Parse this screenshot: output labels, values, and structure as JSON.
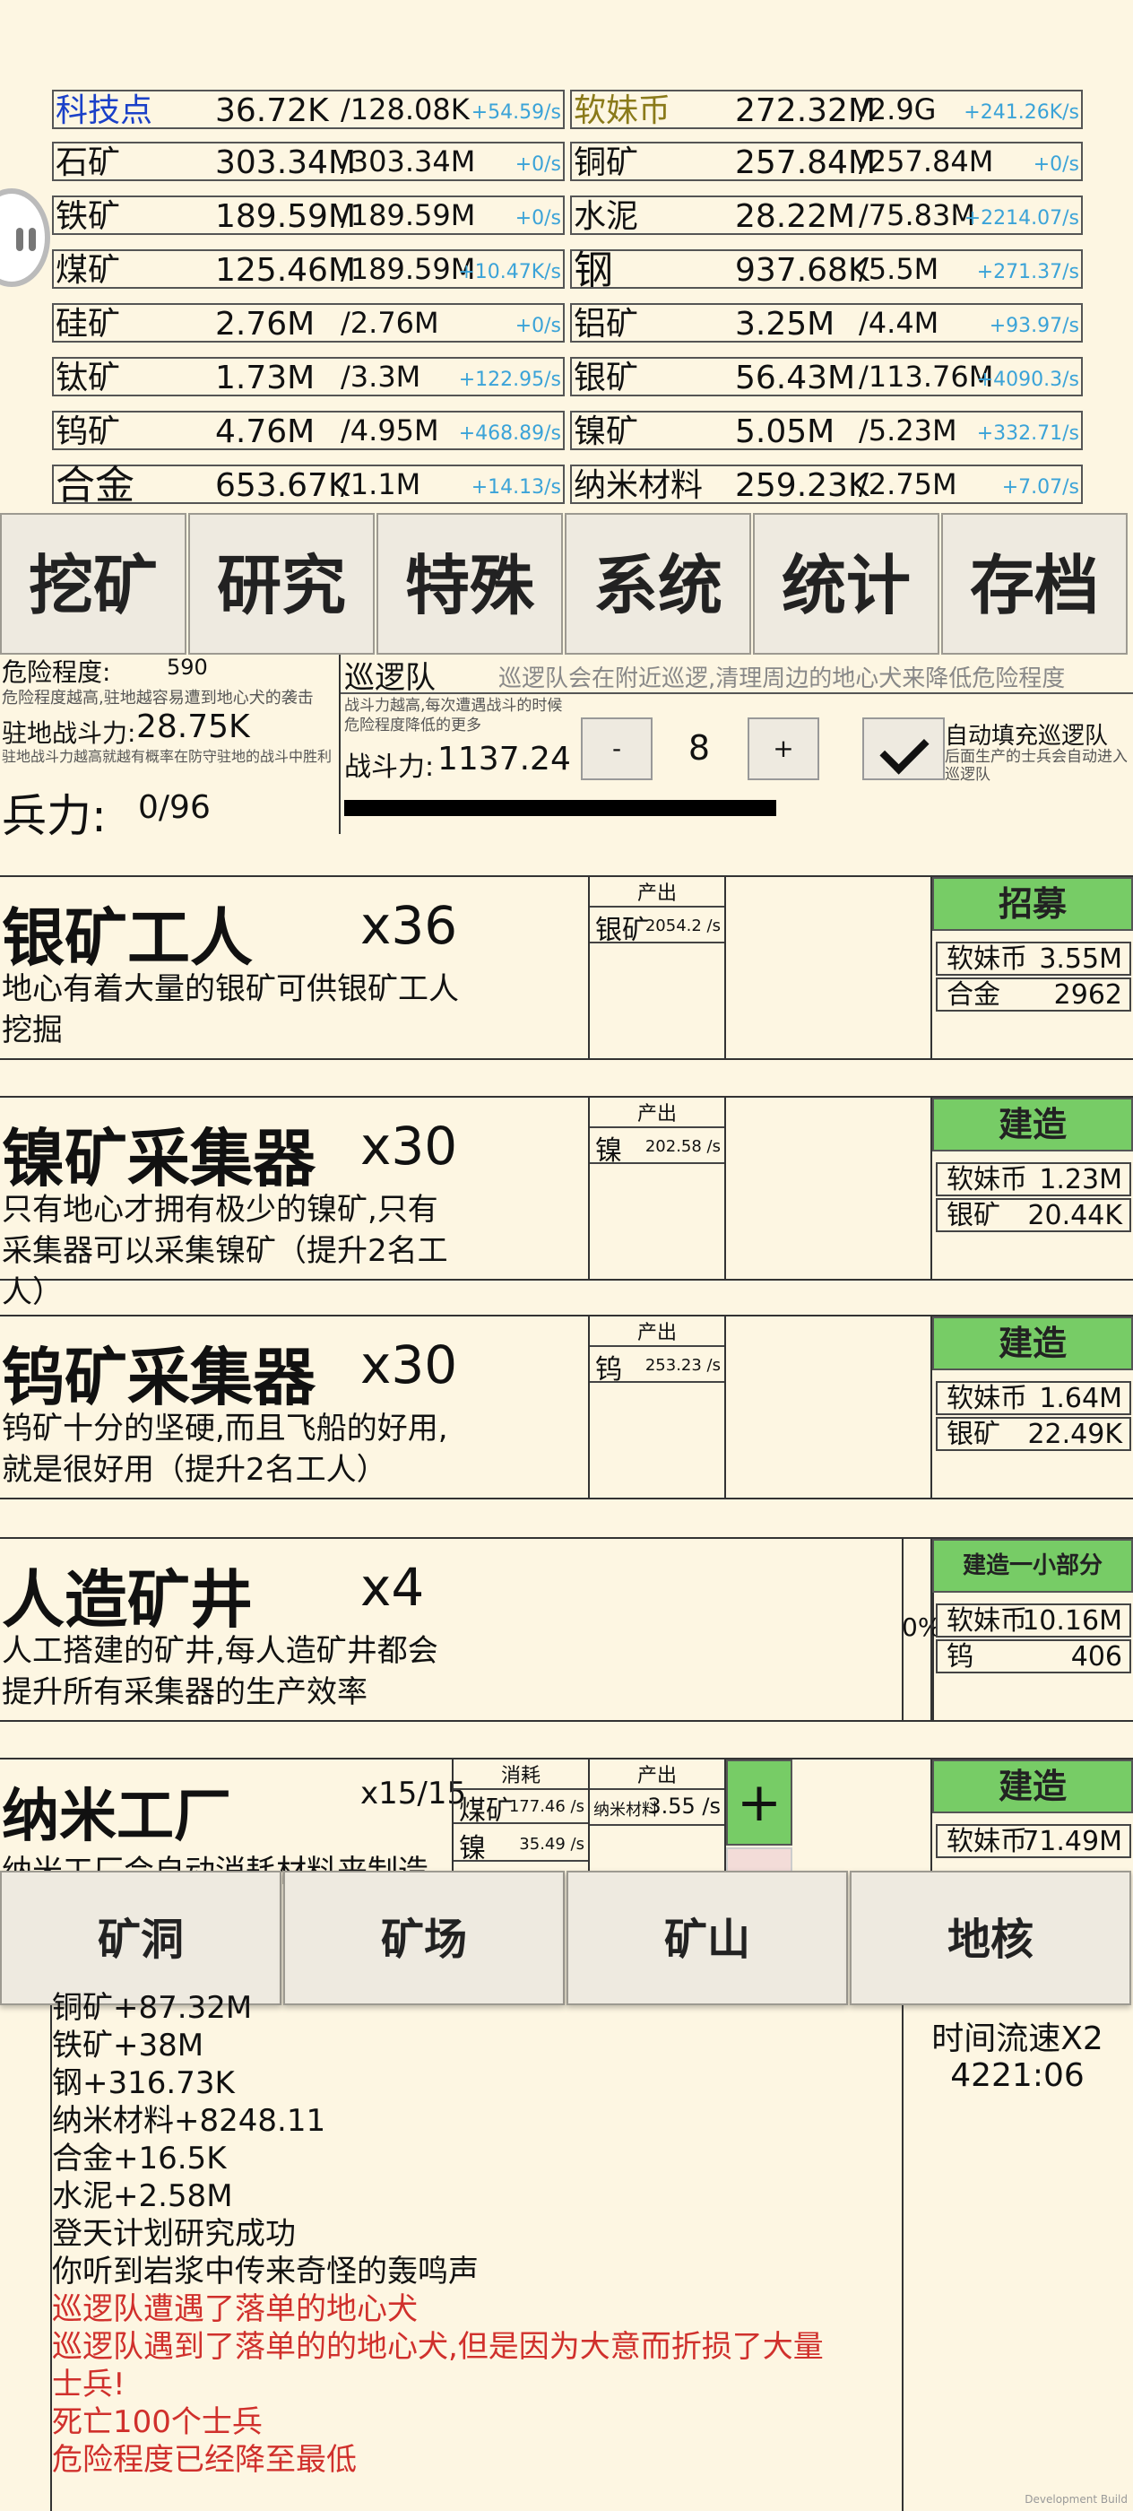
{
  "resources": {
    "left": [
      {
        "name": "科技点",
        "value": "36.72K",
        "max": "/128.08K",
        "rate": "+54.59/s",
        "color": "#1a40c8"
      },
      {
        "name": "石矿",
        "value": "303.34M",
        "max": "/303.34M",
        "rate": "+0/s"
      },
      {
        "name": "铁矿",
        "value": "189.59M",
        "max": "/189.59M",
        "rate": "+0/s"
      },
      {
        "name": "煤矿",
        "value": "125.46M",
        "max": "/189.59M",
        "rate": "+10.47K/s"
      },
      {
        "name": "硅矿",
        "value": "2.76M",
        "max": "/2.76M",
        "rate": "+0/s"
      },
      {
        "name": "钛矿",
        "value": "1.73M",
        "max": "/3.3M",
        "rate": "+122.95/s"
      },
      {
        "name": "钨矿",
        "value": "4.76M",
        "max": "/4.95M",
        "rate": "+468.89/s"
      },
      {
        "name": "合金",
        "value": "653.67K",
        "max": "/1.1M",
        "rate": "+14.13/s"
      }
    ],
    "right": [
      {
        "name": "软妹币",
        "value": "272.32M",
        "max": "/2.9G",
        "rate": "+241.26K/s",
        "color": "#8a7a1a"
      },
      {
        "name": "铜矿",
        "value": "257.84M",
        "max": "/257.84M",
        "rate": "+0/s"
      },
      {
        "name": "水泥",
        "value": "28.22M",
        "max": "/75.83M",
        "rate": "+2214.07/s"
      },
      {
        "name": "钢",
        "value": "937.68K",
        "max": "/5.5M",
        "rate": "+271.37/s"
      },
      {
        "name": "铝矿",
        "value": "3.25M",
        "max": "/4.4M",
        "rate": "+93.97/s"
      },
      {
        "name": "银矿",
        "value": "56.43M",
        "max": "/113.76M",
        "rate": "+4090.3/s"
      },
      {
        "name": "镍矿",
        "value": "5.05M",
        "max": "/5.23M",
        "rate": "+332.71/s"
      },
      {
        "name": "纳米材料",
        "value": "259.23K",
        "max": "/2.75M",
        "rate": "+7.07/s"
      }
    ]
  },
  "tabs": [
    "挖矿",
    "研究",
    "特殊",
    "系统",
    "统计",
    "存档"
  ],
  "danger": {
    "label": "危险程度:",
    "value": "590",
    "hint": "危险程度越高,驻地越容易遭到地心犬的袭击",
    "garrison_label": "驻地战斗力:",
    "garrison_value": "28.75K",
    "garrison_hint": "驻地战斗力越高就越有概率在防守驻地的战斗中胜利",
    "troops_label": "兵力:",
    "troops_value": "0/96"
  },
  "patrol": {
    "title": "巡逻队",
    "desc": "巡逻队会在附近巡逻,清理周边的地心犬来降低危险程度",
    "hint": "战斗力越高,每次遭遇战斗的时候危险程度降低的更多",
    "power_label": "战斗力:",
    "power_value": "1137.24",
    "minus": "-",
    "count": "8",
    "plus": "+",
    "auto_label": "自动填充巡逻队",
    "auto_hint": "后面生产的士兵会自动进入巡逻队",
    "progress": 0.56
  },
  "items": [
    {
      "title": "银矿工人",
      "count": "x36",
      "desc": "地心有着大量的银矿可供银矿工人挖掘",
      "out_head": "产出",
      "out_name": "银矿",
      "out_rate": "2054.2 /s",
      "button": "招募",
      "costs": [
        {
          "name": "软妹币",
          "value": "3.55M"
        },
        {
          "name": "合金",
          "value": "2962"
        }
      ]
    },
    {
      "title": "镍矿采集器",
      "count": "x30",
      "desc": "只有地心才拥有极少的镍矿,只有采集器可以采集镍矿（提升2名工人）",
      "out_head": "产出",
      "out_name": "镍",
      "out_rate": "202.58 /s",
      "button": "建造",
      "costs": [
        {
          "name": "软妹币",
          "value": "1.23M"
        },
        {
          "name": "银矿",
          "value": "20.44K"
        }
      ]
    },
    {
      "title": "钨矿采集器",
      "count": "x30",
      "desc": "钨矿十分的坚硬,而且飞船的好用,就是很好用（提升2名工人）",
      "out_head": "产出",
      "out_name": "钨",
      "out_rate": "253.23 /s",
      "button": "建造",
      "costs": [
        {
          "name": "软妹币",
          "value": "1.64M"
        },
        {
          "name": "银矿",
          "value": "22.49K"
        }
      ]
    },
    {
      "title": "人造矿井",
      "count": "x4",
      "desc": "人工搭建的矿井,每人造矿井都会提升所有采集器的生产效率",
      "percent": "0%",
      "button": "建造一小部分",
      "costs": [
        {
          "name": "软妹币",
          "value": "10.16M"
        },
        {
          "name": "钨",
          "value": "406"
        }
      ]
    },
    {
      "title": "纳米工厂",
      "count": "x15/15",
      "desc": "纳米工厂会自动消耗材料来制造",
      "consume_head": "消耗",
      "consume": [
        {
          "name": "煤矿",
          "rate": "177.46 /s"
        },
        {
          "name": "镍",
          "rate": "35.49 /s"
        }
      ],
      "out_head": "产出",
      "out_name": "纳米材料",
      "out_rate": "3.55 /s",
      "plus": "+",
      "button": "建造",
      "costs": [
        {
          "name": "软妹币",
          "value": "71.49M"
        }
      ]
    }
  ],
  "bottom_tabs": [
    "矿洞",
    "矿场",
    "矿山",
    "地核"
  ],
  "log": [
    {
      "text": "铜矿+87.32M",
      "color": "#111"
    },
    {
      "text": "铁矿+38M",
      "color": "#111"
    },
    {
      "text": "钢+316.73K",
      "color": "#111"
    },
    {
      "text": "纳米材料+8248.11",
      "color": "#111"
    },
    {
      "text": "合金+16.5K",
      "color": "#111"
    },
    {
      "text": "水泥+2.58M",
      "color": "#111"
    },
    {
      "text": "登天计划研究成功",
      "color": "#111"
    },
    {
      "text": "你听到岩浆中传来奇怪的轰鸣声",
      "color": "#111"
    },
    {
      "text": "巡逻队遭遇了落单的地心犬",
      "color": "#d0302c"
    },
    {
      "text": "巡逻队遇到了落单的的地心犬,但是因为大意而折损了大量",
      "color": "#d0302c"
    },
    {
      "text": "士兵!",
      "color": "#d0302c"
    },
    {
      "text": "死亡100个士兵",
      "color": "#d0302c"
    },
    {
      "text": "危险程度已经降至最低",
      "color": "#d0302c"
    }
  ],
  "time": {
    "label": "时间流速X2",
    "clock": "4221:06"
  },
  "watermark": "Development Build"
}
